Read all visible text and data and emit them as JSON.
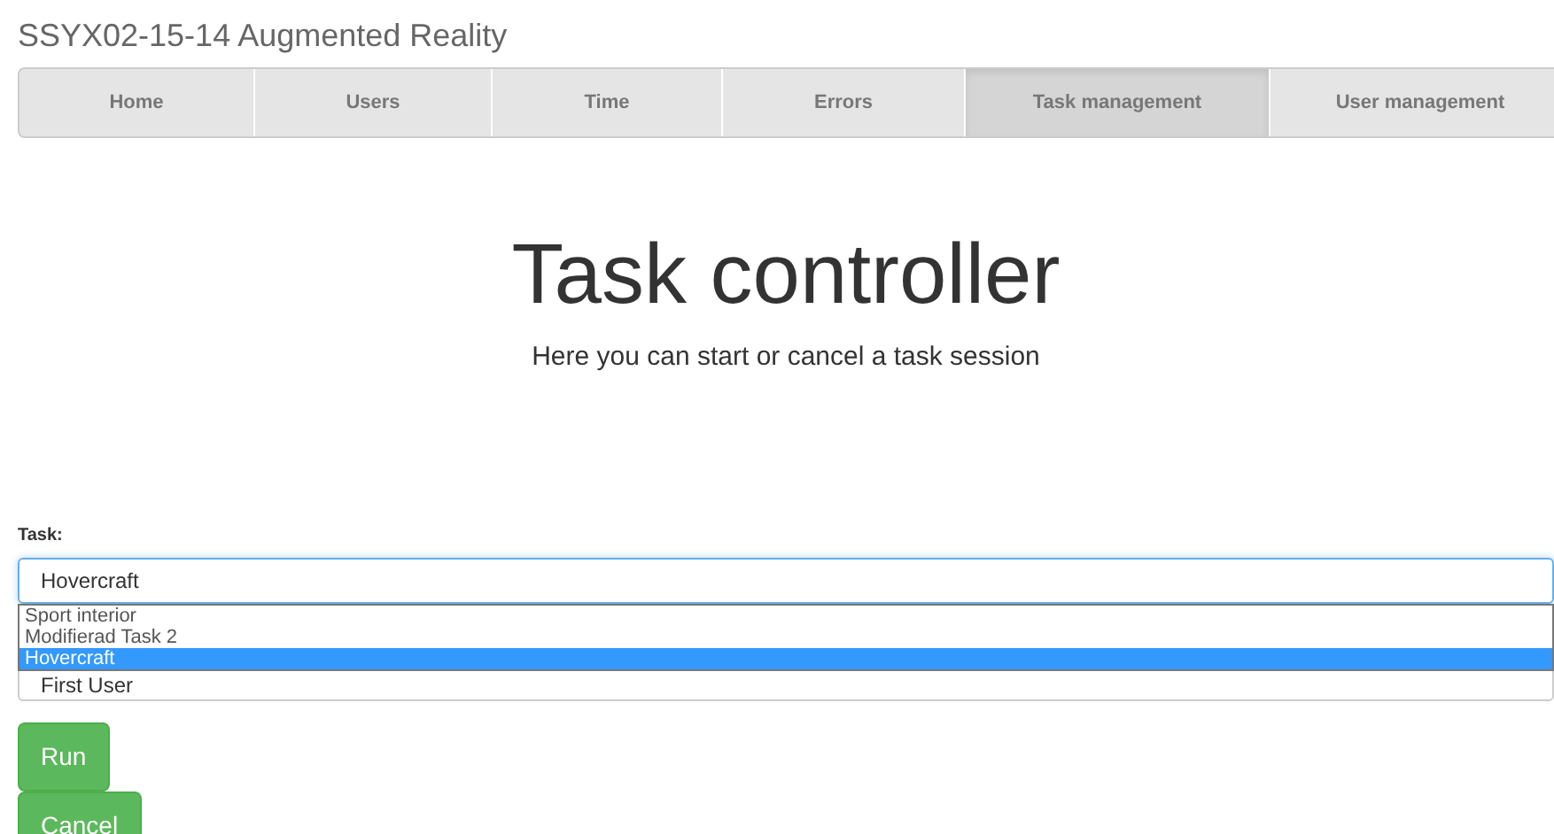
{
  "site_title": "SSYX02-15-14 Augmented Reality",
  "tabs": [
    {
      "label": "Home",
      "selected": false
    },
    {
      "label": "Users",
      "selected": false
    },
    {
      "label": "Time",
      "selected": false
    },
    {
      "label": "Errors",
      "selected": false
    },
    {
      "label": "Task management",
      "selected": true
    },
    {
      "label": "User management",
      "selected": false
    }
  ],
  "heading": "Task controller",
  "subtitle": "Here you can start or cancel a task session",
  "task_field": {
    "label": "Task:",
    "value": "Hovercraft",
    "expanded": true
  },
  "dropdown_options": [
    {
      "label": "Sport interior",
      "selected": false
    },
    {
      "label": "Modifierad Task 2",
      "selected": false
    },
    {
      "label": "Hovercraft",
      "selected": true
    }
  ],
  "user_field": {
    "value": "First User"
  },
  "buttons": [
    {
      "label": "Run"
    },
    {
      "label": "Cancel"
    }
  ]
}
